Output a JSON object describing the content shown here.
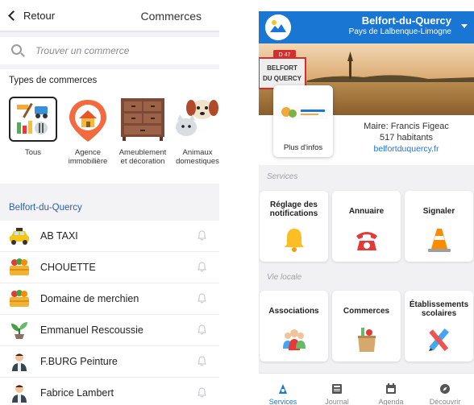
{
  "left_screen": {
    "header": {
      "back_label": "Retour",
      "title": "Commerces"
    },
    "search": {
      "placeholder": "Trouver un commerce"
    },
    "types_title": "Types de commerces",
    "categories": [
      {
        "label": "Tous",
        "icon": "tools-icon"
      },
      {
        "label": "Agence immobilière",
        "icon": "house-pin-icon"
      },
      {
        "label": "Ameublement et décoration",
        "icon": "dresser-icon"
      },
      {
        "label": "Animaux domestiques",
        "icon": "pets-icon"
      }
    ],
    "section_title": "Belfort-du-Quercy",
    "shops": [
      {
        "name": "AB TAXI",
        "icon": "taxi-icon"
      },
      {
        "name": "CHOUETTE",
        "icon": "basket-icon"
      },
      {
        "name": "Domaine de merchien",
        "icon": "basket-icon"
      },
      {
        "name": "Emmanuel Rescoussie",
        "icon": "plant-icon"
      },
      {
        "name": "F.BURG Peinture",
        "icon": "worker-icon"
      },
      {
        "name": "Fabrice Lambert",
        "icon": "worker-icon"
      }
    ]
  },
  "right_screen": {
    "header": {
      "title": "Belfort-du-Quercy",
      "subtitle": "Pays de Lalbenque-Limogne"
    },
    "hero_sign_line1": "D 47",
    "hero_sign_line2": "BELFORT",
    "hero_sign_line3": "DU QUERCY",
    "thumb_label": "Plus d'infos",
    "mayor": {
      "line1": "Maire: Francis Figeac",
      "line2": "517 habitants",
      "link": "belfortduquercy.fr"
    },
    "sections": [
      {
        "label": "Services",
        "tiles": [
          {
            "label": "Réglage des notifications",
            "icon": "bell-icon"
          },
          {
            "label": "Annuaire",
            "icon": "phone-icon"
          },
          {
            "label": "Signaler",
            "icon": "cone-icon"
          }
        ]
      },
      {
        "label": "Vie locale",
        "tiles": [
          {
            "label": "Associations",
            "icon": "people-icon"
          },
          {
            "label": "Commerces",
            "icon": "grocery-bag-icon"
          },
          {
            "label": "Établissements scolaires",
            "icon": "school-tools-icon"
          }
        ]
      }
    ],
    "nav": [
      {
        "label": "Services",
        "icon": "services-icon",
        "active": true
      },
      {
        "label": "Journal",
        "icon": "newspaper-icon",
        "active": false
      },
      {
        "label": "Agenda",
        "icon": "calendar-icon",
        "active": false
      },
      {
        "label": "Découvrir",
        "icon": "compass-icon",
        "active": false
      }
    ],
    "colors": {
      "primary": "#1976d2",
      "link": "#1a73e8"
    }
  }
}
